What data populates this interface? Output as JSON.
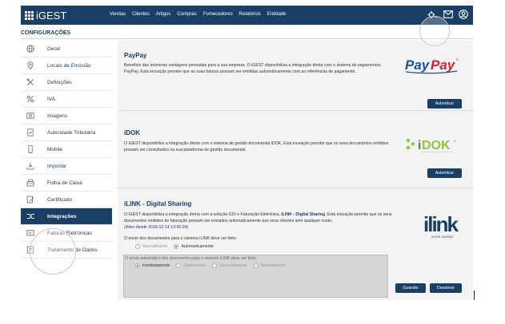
{
  "app": {
    "brand": "iGEST",
    "nav": [
      "Vendas",
      "Clientes",
      "Artigos",
      "Compras",
      "Fornecedores",
      "Relatórios",
      "Entidade"
    ]
  },
  "page": {
    "title": "CONFIGURAÇÕES"
  },
  "sidebar": {
    "items": [
      {
        "label": "Geral",
        "icon": "globe-icon"
      },
      {
        "label": "Locais de Emissão",
        "icon": "location-pin-icon"
      },
      {
        "label": "Definições",
        "icon": "tools-icon"
      },
      {
        "label": "IVA",
        "icon": "percent-icon"
      },
      {
        "label": "Imagens",
        "icon": "image-icon"
      },
      {
        "label": "Autoridade Tributária",
        "icon": "document-check-icon"
      },
      {
        "label": "Mobile",
        "icon": "mobile-icon"
      },
      {
        "label": "Importar",
        "icon": "import-icon"
      },
      {
        "label": "Folha de Caixa",
        "icon": "cash-register-icon"
      },
      {
        "label": "Certificado",
        "icon": "certificate-edit-icon"
      },
      {
        "label": "Integrações",
        "icon": "integration-arrows-icon",
        "active": true
      },
      {
        "label": "Faturas Eletrónicas",
        "icon": "e-invoice-icon"
      },
      {
        "label": "Tratamento de Dados",
        "icon": "data-treatment-icon"
      }
    ]
  },
  "paypay": {
    "title": "PayPay",
    "description": "Beneficie das inúmeras vantagens pensadas para a sua empresa. O iGEST disponibiliza a integração direta com o sistema de pagamentos PayPay. Esta inovação permite que as suas faturas possam ser emitidas automaticamente com as referências de pagamento.",
    "logo": "PayPay",
    "button": "Autenticar"
  },
  "idok": {
    "title": "iDOK",
    "description": "O iGEST disponibiliza a integração direta com o sistema de gestão documental IDOK. Esta inovação permite que os seus documentos emitidos possam ser consultados na sua plataforma de gestão documental.",
    "logo": "iDOK",
    "button": "Autenticar"
  },
  "ilink": {
    "title": "iLINK - Digital Sharing",
    "desc_a": "O iGEST disponibiliza a integração direta com a solução EDI e Faturação Eletrónica, ",
    "desc_b": "iLINK - Digital Sharing",
    "desc_c": ". Esta inovação permite que os seus documentos emitidos de faturação possam ser enviados automaticamente aos seus clientes sem qualquer custo.",
    "active_since": "(Ativo desde 2018-12-14 13:42:34)",
    "send_label": "O envio dos documentos para o sistema iLINK deve ser feito:",
    "send_options": [
      "Manualmente",
      "Automaticamente"
    ],
    "send_selected": "Automaticamente",
    "auto_label": "O envio automático dos documento para o sistema iLINK deve ser feito:",
    "auto_options": [
      "Imediatamente",
      "Diariamente",
      "Semanalmente",
      "Mensalmente"
    ],
    "auto_selected": "Imediatamente",
    "logo_text": "ilink",
    "logo_sub": "DIGITAL SHARING",
    "save_button": "Guardar",
    "deactivate_button": "Desativar"
  },
  "colors": {
    "primary": "#1a3f66",
    "paypay_blue": "#1f4e9c",
    "paypay_red": "#d3202f",
    "idok_green": "#8cc63f",
    "idok_gray": "#6d6e71"
  }
}
